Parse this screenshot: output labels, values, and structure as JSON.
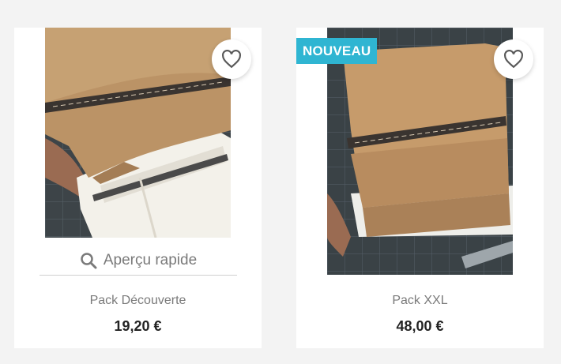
{
  "products": [
    {
      "name": "Pack Découverte",
      "price": "19,20 €",
      "quick_view_label": "Aperçu rapide",
      "favorite_icon": "heart-icon"
    },
    {
      "name": "Pack XXL",
      "price": "48,00 €",
      "badge": "NOUVEAU",
      "favorite_icon": "heart-icon"
    }
  ],
  "colors": {
    "badge_bg": "#2fb5d2",
    "price_text": "#232323",
    "muted_text": "#7a7a7a",
    "page_bg": "#f3f3f3"
  }
}
